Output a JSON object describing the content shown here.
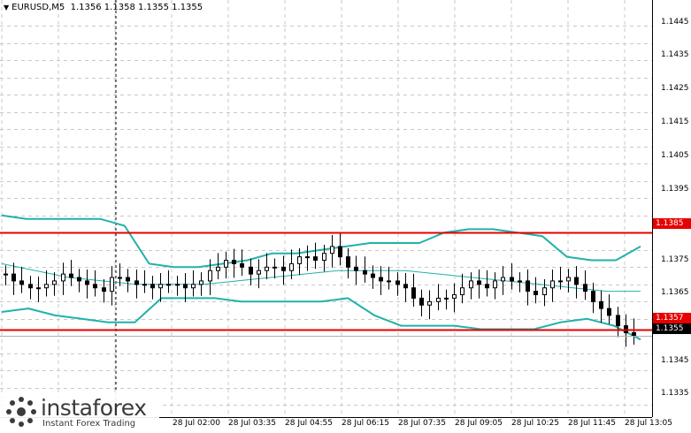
{
  "header": {
    "symbol_timeframe": "EURUSD,M5",
    "ohlc": "1.1356 1.1358 1.1355 1.1355"
  },
  "price_axis": {
    "labels": [
      "1.1445",
      "1.1435",
      "1.1425",
      "1.1415",
      "1.1405",
      "1.1395",
      "1.1375",
      "1.1365",
      "1.1345",
      "1.1335"
    ],
    "tags": {
      "upper_level": "1.1385",
      "lower_level": "1.1357",
      "current": "1.1355"
    }
  },
  "time_axis": {
    "labels": [
      "28 Jul 02:00",
      "28 Jul 03:35",
      "28 Jul 04:55",
      "28 Jul 06:15",
      "28 Jul 07:35",
      "28 Jul 09:05",
      "28 Jul 10:25",
      "28 Jul 11:45",
      "28 Jul 13:05"
    ]
  },
  "watermark": {
    "name": "instaforex",
    "tagline": "Instant Forex Trading"
  },
  "colors": {
    "level_line": "#e60000",
    "bollinger": "#20b2aa",
    "grid": "#c8c8c8",
    "candles": "#000000"
  },
  "chart_data": {
    "type": "candlestick",
    "symbol": "EURUSD",
    "timeframe": "M5",
    "ylim": [
      1.13315,
      1.14525
    ],
    "horizontal_levels": [
      1.1385,
      1.1357
    ],
    "bid_line": 1.1355,
    "close_path": [
      1.1373,
      1.1371,
      1.137,
      1.1369,
      1.1369,
      1.137,
      1.1371,
      1.1373,
      1.1372,
      1.1371,
      1.137,
      1.1369,
      1.1368,
      1.1372,
      1.1372,
      1.1371,
      1.137,
      1.137,
      1.1369,
      1.137,
      1.137,
      1.137,
      1.1369,
      1.137,
      1.1371,
      1.1374,
      1.1375,
      1.1377,
      1.1376,
      1.1375,
      1.1373,
      1.1374,
      1.1375,
      1.1375,
      1.1374,
      1.1376,
      1.1378,
      1.1378,
      1.1377,
      1.1379,
      1.1381,
      1.1378,
      1.1375,
      1.1374,
      1.1373,
      1.1372,
      1.1371,
      1.1371,
      1.137,
      1.1369,
      1.1366,
      1.1364,
      1.1365,
      1.1366,
      1.1366,
      1.1367,
      1.1369,
      1.1371,
      1.137,
      1.1369,
      1.1371,
      1.1372,
      1.1371,
      1.1371,
      1.1368,
      1.1367,
      1.1369,
      1.1371,
      1.1371,
      1.1372,
      1.137,
      1.1368,
      1.1365,
      1.1363,
      1.1361,
      1.1358,
      1.1356,
      1.1355
    ],
    "bollinger_upper_path": [
      1.139,
      1.1389,
      1.1389,
      1.1389,
      1.1389,
      1.1387,
      1.1376,
      1.1375,
      1.1375,
      1.1376,
      1.1377,
      1.1379,
      1.1379,
      1.138,
      1.1381,
      1.1382,
      1.1382,
      1.1382,
      1.1385,
      1.1386,
      1.1386,
      1.1385,
      1.1384,
      1.1378,
      1.1377,
      1.1377,
      1.1381
    ],
    "bollinger_middle_path": [
      1.1376,
      1.1374,
      1.1372,
      1.1371,
      1.137,
      1.137,
      1.137,
      1.1371,
      1.1372,
      1.1373,
      1.1374,
      1.1374,
      1.1374,
      1.1373,
      1.1372,
      1.1371,
      1.137,
      1.1369,
      1.1368,
      1.1368
    ],
    "bollinger_lower_path": [
      1.1362,
      1.1363,
      1.1361,
      1.136,
      1.1359,
      1.1359,
      1.1366,
      1.1366,
      1.1366,
      1.1365,
      1.1365,
      1.1365,
      1.1365,
      1.1366,
      1.1361,
      1.1358,
      1.1358,
      1.1358,
      1.1357,
      1.1357,
      1.1357,
      1.1359,
      1.136,
      1.1358,
      1.1354
    ]
  }
}
